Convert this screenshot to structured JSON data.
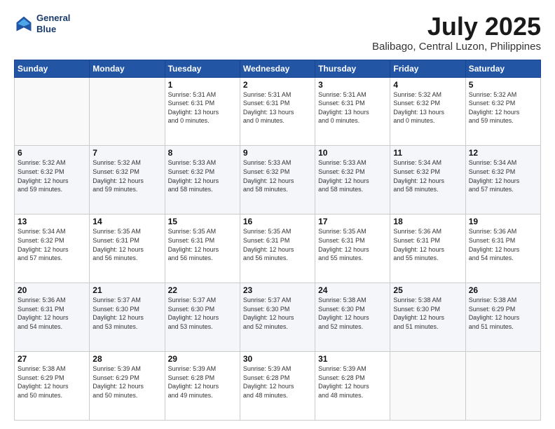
{
  "header": {
    "logo_line1": "General",
    "logo_line2": "Blue",
    "title": "July 2025",
    "subtitle": "Balibago, Central Luzon, Philippines"
  },
  "columns": [
    "Sunday",
    "Monday",
    "Tuesday",
    "Wednesday",
    "Thursday",
    "Friday",
    "Saturday"
  ],
  "weeks": [
    [
      {
        "day": "",
        "info": ""
      },
      {
        "day": "",
        "info": ""
      },
      {
        "day": "1",
        "info": "Sunrise: 5:31 AM\nSunset: 6:31 PM\nDaylight: 13 hours\nand 0 minutes."
      },
      {
        "day": "2",
        "info": "Sunrise: 5:31 AM\nSunset: 6:31 PM\nDaylight: 13 hours\nand 0 minutes."
      },
      {
        "day": "3",
        "info": "Sunrise: 5:31 AM\nSunset: 6:31 PM\nDaylight: 13 hours\nand 0 minutes."
      },
      {
        "day": "4",
        "info": "Sunrise: 5:32 AM\nSunset: 6:32 PM\nDaylight: 13 hours\nand 0 minutes."
      },
      {
        "day": "5",
        "info": "Sunrise: 5:32 AM\nSunset: 6:32 PM\nDaylight: 12 hours\nand 59 minutes."
      }
    ],
    [
      {
        "day": "6",
        "info": "Sunrise: 5:32 AM\nSunset: 6:32 PM\nDaylight: 12 hours\nand 59 minutes."
      },
      {
        "day": "7",
        "info": "Sunrise: 5:32 AM\nSunset: 6:32 PM\nDaylight: 12 hours\nand 59 minutes."
      },
      {
        "day": "8",
        "info": "Sunrise: 5:33 AM\nSunset: 6:32 PM\nDaylight: 12 hours\nand 58 minutes."
      },
      {
        "day": "9",
        "info": "Sunrise: 5:33 AM\nSunset: 6:32 PM\nDaylight: 12 hours\nand 58 minutes."
      },
      {
        "day": "10",
        "info": "Sunrise: 5:33 AM\nSunset: 6:32 PM\nDaylight: 12 hours\nand 58 minutes."
      },
      {
        "day": "11",
        "info": "Sunrise: 5:34 AM\nSunset: 6:32 PM\nDaylight: 12 hours\nand 58 minutes."
      },
      {
        "day": "12",
        "info": "Sunrise: 5:34 AM\nSunset: 6:32 PM\nDaylight: 12 hours\nand 57 minutes."
      }
    ],
    [
      {
        "day": "13",
        "info": "Sunrise: 5:34 AM\nSunset: 6:32 PM\nDaylight: 12 hours\nand 57 minutes."
      },
      {
        "day": "14",
        "info": "Sunrise: 5:35 AM\nSunset: 6:31 PM\nDaylight: 12 hours\nand 56 minutes."
      },
      {
        "day": "15",
        "info": "Sunrise: 5:35 AM\nSunset: 6:31 PM\nDaylight: 12 hours\nand 56 minutes."
      },
      {
        "day": "16",
        "info": "Sunrise: 5:35 AM\nSunset: 6:31 PM\nDaylight: 12 hours\nand 56 minutes."
      },
      {
        "day": "17",
        "info": "Sunrise: 5:35 AM\nSunset: 6:31 PM\nDaylight: 12 hours\nand 55 minutes."
      },
      {
        "day": "18",
        "info": "Sunrise: 5:36 AM\nSunset: 6:31 PM\nDaylight: 12 hours\nand 55 minutes."
      },
      {
        "day": "19",
        "info": "Sunrise: 5:36 AM\nSunset: 6:31 PM\nDaylight: 12 hours\nand 54 minutes."
      }
    ],
    [
      {
        "day": "20",
        "info": "Sunrise: 5:36 AM\nSunset: 6:31 PM\nDaylight: 12 hours\nand 54 minutes."
      },
      {
        "day": "21",
        "info": "Sunrise: 5:37 AM\nSunset: 6:30 PM\nDaylight: 12 hours\nand 53 minutes."
      },
      {
        "day": "22",
        "info": "Sunrise: 5:37 AM\nSunset: 6:30 PM\nDaylight: 12 hours\nand 53 minutes."
      },
      {
        "day": "23",
        "info": "Sunrise: 5:37 AM\nSunset: 6:30 PM\nDaylight: 12 hours\nand 52 minutes."
      },
      {
        "day": "24",
        "info": "Sunrise: 5:38 AM\nSunset: 6:30 PM\nDaylight: 12 hours\nand 52 minutes."
      },
      {
        "day": "25",
        "info": "Sunrise: 5:38 AM\nSunset: 6:30 PM\nDaylight: 12 hours\nand 51 minutes."
      },
      {
        "day": "26",
        "info": "Sunrise: 5:38 AM\nSunset: 6:29 PM\nDaylight: 12 hours\nand 51 minutes."
      }
    ],
    [
      {
        "day": "27",
        "info": "Sunrise: 5:38 AM\nSunset: 6:29 PM\nDaylight: 12 hours\nand 50 minutes."
      },
      {
        "day": "28",
        "info": "Sunrise: 5:39 AM\nSunset: 6:29 PM\nDaylight: 12 hours\nand 50 minutes."
      },
      {
        "day": "29",
        "info": "Sunrise: 5:39 AM\nSunset: 6:28 PM\nDaylight: 12 hours\nand 49 minutes."
      },
      {
        "day": "30",
        "info": "Sunrise: 5:39 AM\nSunset: 6:28 PM\nDaylight: 12 hours\nand 48 minutes."
      },
      {
        "day": "31",
        "info": "Sunrise: 5:39 AM\nSunset: 6:28 PM\nDaylight: 12 hours\nand 48 minutes."
      },
      {
        "day": "",
        "info": ""
      },
      {
        "day": "",
        "info": ""
      }
    ]
  ]
}
